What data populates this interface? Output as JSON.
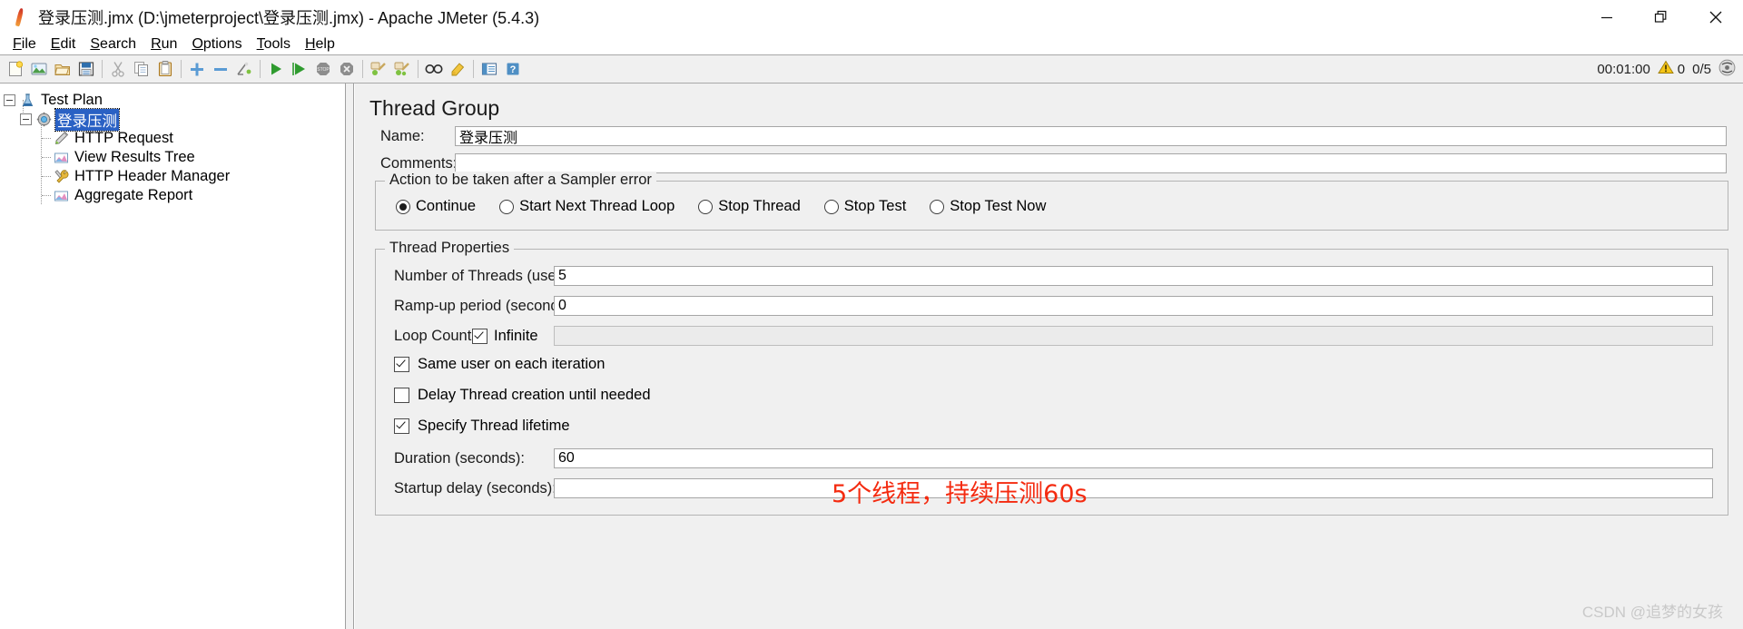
{
  "window": {
    "title": "登录压测.jmx (D:\\jmeterproject\\登录压测.jmx) - Apache JMeter (5.4.3)",
    "app_icon": "jmeter-feather-icon",
    "minimize_label": "Minimize",
    "maximize_label": "Maximize",
    "close_label": "Close"
  },
  "menubar": {
    "items": [
      {
        "label": "File",
        "mnemonic": "F",
        "rest": "ile"
      },
      {
        "label": "Edit",
        "mnemonic": "E",
        "rest": "dit"
      },
      {
        "label": "Search",
        "mnemonic": "S",
        "rest": "earch"
      },
      {
        "label": "Run",
        "mnemonic": "R",
        "rest": "un"
      },
      {
        "label": "Options",
        "mnemonic": "O",
        "rest": "ptions"
      },
      {
        "label": "Tools",
        "mnemonic": "T",
        "rest": "ools"
      },
      {
        "label": "Help",
        "mnemonic": "H",
        "rest": "elp"
      }
    ]
  },
  "toolbar": {
    "buttons": [
      {
        "name": "new-icon",
        "title": "New"
      },
      {
        "name": "templates-icon",
        "title": "Templates"
      },
      {
        "name": "open-icon",
        "title": "Open"
      },
      {
        "name": "save-icon",
        "title": "Save"
      },
      {
        "name": "separator-1",
        "title": ""
      },
      {
        "name": "cut-icon",
        "title": "Cut"
      },
      {
        "name": "copy-icon",
        "title": "Copy"
      },
      {
        "name": "paste-icon",
        "title": "Paste"
      },
      {
        "name": "separator-2",
        "title": ""
      },
      {
        "name": "expand-all-icon",
        "title": "Expand All"
      },
      {
        "name": "collapse-all-icon",
        "title": "Collapse All"
      },
      {
        "name": "toggle-icon",
        "title": "Toggle"
      },
      {
        "name": "separator-3",
        "title": ""
      },
      {
        "name": "start-icon",
        "title": "Start"
      },
      {
        "name": "start-no-timers-icon",
        "title": "Start no pauses"
      },
      {
        "name": "stop-icon",
        "title": "Stop"
      },
      {
        "name": "shutdown-icon",
        "title": "Shutdown"
      },
      {
        "name": "separator-4",
        "title": ""
      },
      {
        "name": "clear-icon",
        "title": "Clear"
      },
      {
        "name": "clear-all-icon",
        "title": "Clear All"
      },
      {
        "name": "separator-5",
        "title": ""
      },
      {
        "name": "search-icon",
        "title": "Search"
      },
      {
        "name": "search-reset-icon",
        "title": "Reset Search"
      },
      {
        "name": "separator-6",
        "title": ""
      },
      {
        "name": "function-helper-icon",
        "title": "Function Helper Dialog"
      },
      {
        "name": "help-icon",
        "title": "Help"
      }
    ],
    "status": {
      "elapsed_time": "00:01:00",
      "warning_icon": "warning-triangle-icon",
      "warning_count": "0",
      "threads": "0/5",
      "activity_icon": "activity-indicator-icon"
    }
  },
  "tree": {
    "nodes": [
      {
        "label": "Test Plan",
        "icon": "test-plan-icon",
        "depth": 0,
        "expanded": true,
        "selected": false
      },
      {
        "label": "登录压测",
        "icon": "thread-group-icon",
        "depth": 1,
        "expanded": true,
        "selected": true
      },
      {
        "label": "HTTP Request",
        "icon": "http-request-icon",
        "depth": 2,
        "expanded": false,
        "selected": false
      },
      {
        "label": "View Results Tree",
        "icon": "view-results-tree-icon",
        "depth": 2,
        "expanded": false,
        "selected": false
      },
      {
        "label": "HTTP Header Manager",
        "icon": "http-header-manager-icon",
        "depth": 2,
        "expanded": false,
        "selected": false
      },
      {
        "label": "Aggregate Report",
        "icon": "aggregate-report-icon",
        "depth": 2,
        "expanded": false,
        "selected": false
      }
    ]
  },
  "panel": {
    "title": "Thread Group",
    "name_label": "Name:",
    "name_value": "登录压测",
    "comments_label": "Comments:",
    "comments_value": "",
    "sampler_error": {
      "legend": "Action to be taken after a Sampler error",
      "options": [
        {
          "label": "Continue",
          "selected": true
        },
        {
          "label": "Start Next Thread Loop",
          "selected": false
        },
        {
          "label": "Stop Thread",
          "selected": false
        },
        {
          "label": "Stop Test",
          "selected": false
        },
        {
          "label": "Stop Test Now",
          "selected": false
        }
      ]
    },
    "thread_properties": {
      "legend": "Thread Properties",
      "num_threads_label": "Number of Threads (users):",
      "num_threads_value": "5",
      "ramp_up_label": "Ramp-up period (seconds):",
      "ramp_up_value": "0",
      "loop_count_label": "Loop Count:",
      "infinite_label": "Infinite",
      "infinite_checked": true,
      "loop_count_value": "",
      "same_user_label": "Same user on each iteration",
      "same_user_checked": true,
      "delay_thread_label": "Delay Thread creation until needed",
      "delay_thread_checked": false,
      "specify_lifetime_label": "Specify Thread lifetime",
      "specify_lifetime_checked": true,
      "duration_label": "Duration (seconds):",
      "duration_value": "60",
      "startup_delay_label": "Startup delay (seconds):",
      "startup_delay_value": ""
    }
  },
  "annotation": {
    "text": "5个线程，持续压测60s",
    "color": "#f42b10"
  },
  "watermark": {
    "text": "CSDN @追梦的女孩"
  }
}
